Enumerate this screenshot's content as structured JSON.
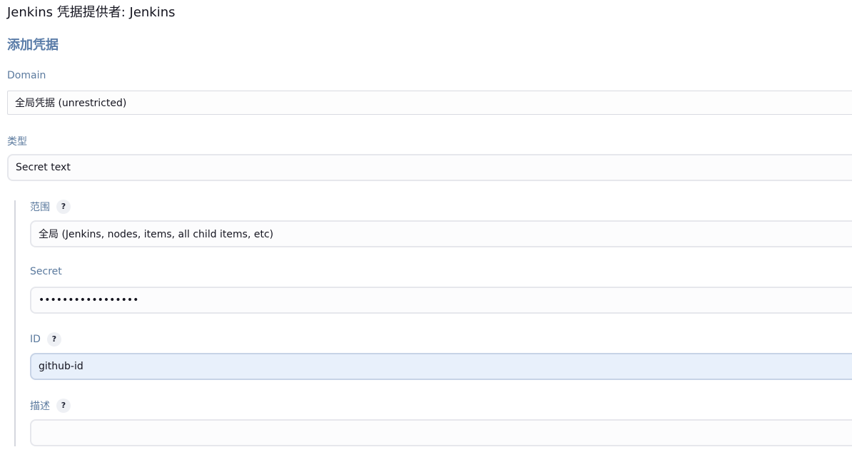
{
  "header": {
    "provider_title": "Jenkins 凭据提供者: Jenkins",
    "section_title": "添加凭据"
  },
  "form": {
    "domain": {
      "label": "Domain",
      "value": "全局凭据 (unrestricted)"
    },
    "kind": {
      "label": "类型",
      "value": "Secret text"
    },
    "scope": {
      "label": "范围",
      "help": "?",
      "value": "全局 (Jenkins, nodes, items, all child items, etc)"
    },
    "secret": {
      "label": "Secret",
      "value": "•••••••••••••••••"
    },
    "id": {
      "label": "ID",
      "help": "?",
      "value": "github-id"
    },
    "description": {
      "label": "描述",
      "help": "?",
      "value": ""
    }
  },
  "colors": {
    "label": "#5b7a9e",
    "section_title": "#5a7ca8",
    "focused_field": "#e8f0fb",
    "border": "#e6e7ec"
  },
  "icons": {
    "help": "question-mark-icon"
  }
}
